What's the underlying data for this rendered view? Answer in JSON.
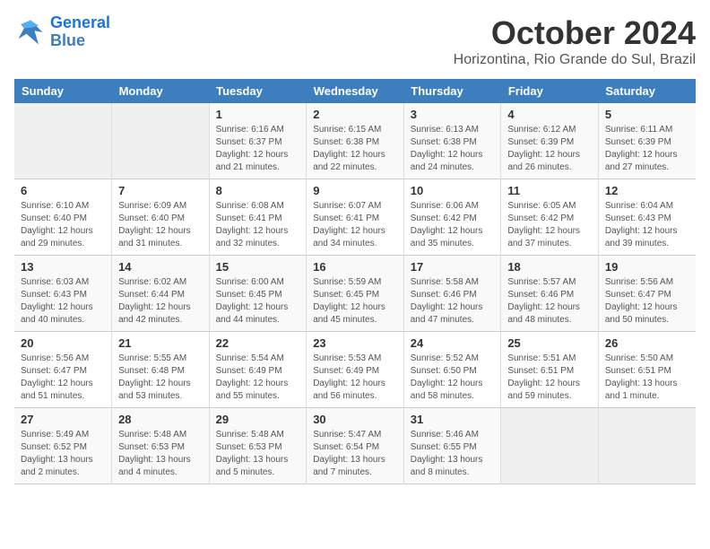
{
  "header": {
    "logo_line1": "General",
    "logo_line2": "Blue",
    "month_title": "October 2024",
    "location": "Horizontina, Rio Grande do Sul, Brazil"
  },
  "weekdays": [
    "Sunday",
    "Monday",
    "Tuesday",
    "Wednesday",
    "Thursday",
    "Friday",
    "Saturday"
  ],
  "weeks": [
    [
      {
        "day": "",
        "empty": true
      },
      {
        "day": "",
        "empty": true
      },
      {
        "day": "1",
        "sunrise": "6:16 AM",
        "sunset": "6:37 PM",
        "daylight": "12 hours and 21 minutes."
      },
      {
        "day": "2",
        "sunrise": "6:15 AM",
        "sunset": "6:38 PM",
        "daylight": "12 hours and 22 minutes."
      },
      {
        "day": "3",
        "sunrise": "6:13 AM",
        "sunset": "6:38 PM",
        "daylight": "12 hours and 24 minutes."
      },
      {
        "day": "4",
        "sunrise": "6:12 AM",
        "sunset": "6:39 PM",
        "daylight": "12 hours and 26 minutes."
      },
      {
        "day": "5",
        "sunrise": "6:11 AM",
        "sunset": "6:39 PM",
        "daylight": "12 hours and 27 minutes."
      }
    ],
    [
      {
        "day": "6",
        "sunrise": "6:10 AM",
        "sunset": "6:40 PM",
        "daylight": "12 hours and 29 minutes."
      },
      {
        "day": "7",
        "sunrise": "6:09 AM",
        "sunset": "6:40 PM",
        "daylight": "12 hours and 31 minutes."
      },
      {
        "day": "8",
        "sunrise": "6:08 AM",
        "sunset": "6:41 PM",
        "daylight": "12 hours and 32 minutes."
      },
      {
        "day": "9",
        "sunrise": "6:07 AM",
        "sunset": "6:41 PM",
        "daylight": "12 hours and 34 minutes."
      },
      {
        "day": "10",
        "sunrise": "6:06 AM",
        "sunset": "6:42 PM",
        "daylight": "12 hours and 35 minutes."
      },
      {
        "day": "11",
        "sunrise": "6:05 AM",
        "sunset": "6:42 PM",
        "daylight": "12 hours and 37 minutes."
      },
      {
        "day": "12",
        "sunrise": "6:04 AM",
        "sunset": "6:43 PM",
        "daylight": "12 hours and 39 minutes."
      }
    ],
    [
      {
        "day": "13",
        "sunrise": "6:03 AM",
        "sunset": "6:43 PM",
        "daylight": "12 hours and 40 minutes."
      },
      {
        "day": "14",
        "sunrise": "6:02 AM",
        "sunset": "6:44 PM",
        "daylight": "12 hours and 42 minutes."
      },
      {
        "day": "15",
        "sunrise": "6:00 AM",
        "sunset": "6:45 PM",
        "daylight": "12 hours and 44 minutes."
      },
      {
        "day": "16",
        "sunrise": "5:59 AM",
        "sunset": "6:45 PM",
        "daylight": "12 hours and 45 minutes."
      },
      {
        "day": "17",
        "sunrise": "5:58 AM",
        "sunset": "6:46 PM",
        "daylight": "12 hours and 47 minutes."
      },
      {
        "day": "18",
        "sunrise": "5:57 AM",
        "sunset": "6:46 PM",
        "daylight": "12 hours and 48 minutes."
      },
      {
        "day": "19",
        "sunrise": "5:56 AM",
        "sunset": "6:47 PM",
        "daylight": "12 hours and 50 minutes."
      }
    ],
    [
      {
        "day": "20",
        "sunrise": "5:56 AM",
        "sunset": "6:47 PM",
        "daylight": "12 hours and 51 minutes."
      },
      {
        "day": "21",
        "sunrise": "5:55 AM",
        "sunset": "6:48 PM",
        "daylight": "12 hours and 53 minutes."
      },
      {
        "day": "22",
        "sunrise": "5:54 AM",
        "sunset": "6:49 PM",
        "daylight": "12 hours and 55 minutes."
      },
      {
        "day": "23",
        "sunrise": "5:53 AM",
        "sunset": "6:49 PM",
        "daylight": "12 hours and 56 minutes."
      },
      {
        "day": "24",
        "sunrise": "5:52 AM",
        "sunset": "6:50 PM",
        "daylight": "12 hours and 58 minutes."
      },
      {
        "day": "25",
        "sunrise": "5:51 AM",
        "sunset": "6:51 PM",
        "daylight": "12 hours and 59 minutes."
      },
      {
        "day": "26",
        "sunrise": "5:50 AM",
        "sunset": "6:51 PM",
        "daylight": "13 hours and 1 minute."
      }
    ],
    [
      {
        "day": "27",
        "sunrise": "5:49 AM",
        "sunset": "6:52 PM",
        "daylight": "13 hours and 2 minutes."
      },
      {
        "day": "28",
        "sunrise": "5:48 AM",
        "sunset": "6:53 PM",
        "daylight": "13 hours and 4 minutes."
      },
      {
        "day": "29",
        "sunrise": "5:48 AM",
        "sunset": "6:53 PM",
        "daylight": "13 hours and 5 minutes."
      },
      {
        "day": "30",
        "sunrise": "5:47 AM",
        "sunset": "6:54 PM",
        "daylight": "13 hours and 7 minutes."
      },
      {
        "day": "31",
        "sunrise": "5:46 AM",
        "sunset": "6:55 PM",
        "daylight": "13 hours and 8 minutes."
      },
      {
        "day": "",
        "empty": true
      },
      {
        "day": "",
        "empty": true
      }
    ]
  ]
}
